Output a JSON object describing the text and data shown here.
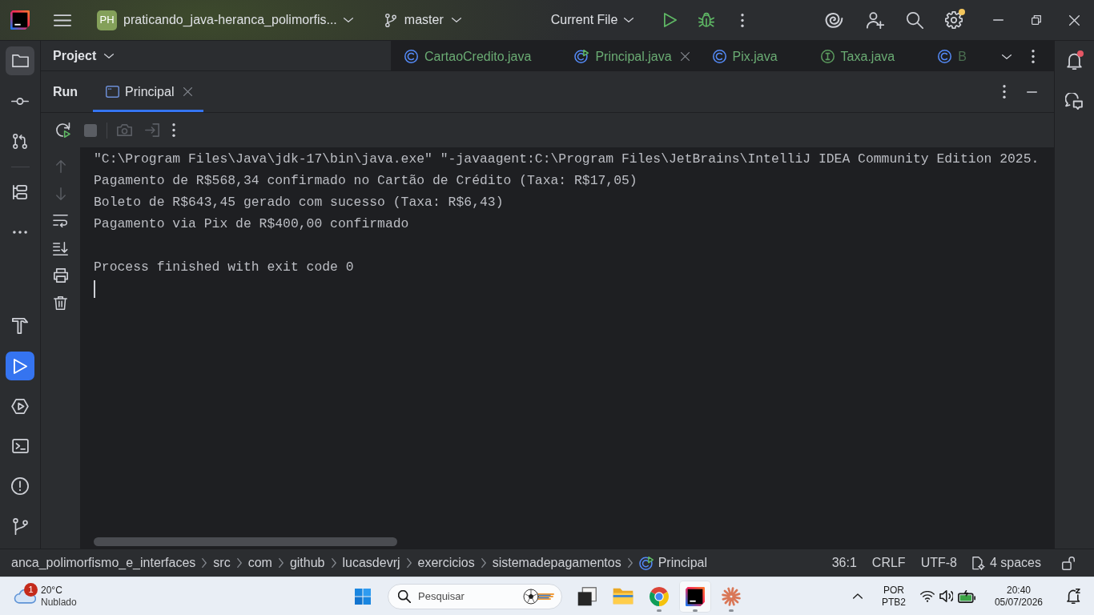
{
  "title_bar": {
    "project_badge": "PH",
    "project_name": "praticando_java-heranca_polimorfis...",
    "branch": "master",
    "run_configuration": "Current File",
    "settings_update_available": true
  },
  "left_toolbar": {
    "top_groups": [
      [
        {
          "kind": "project",
          "selected": false,
          "hovered": true
        },
        {
          "kind": "commit",
          "selected": false,
          "hovered": false
        },
        {
          "kind": "pull_requests",
          "selected": false,
          "hovered": false
        }
      ],
      [
        {
          "kind": "structure",
          "selected": false,
          "hovered": false
        },
        {
          "kind": "more",
          "selected": false,
          "hovered": false
        }
      ]
    ],
    "bottom": [
      {
        "kind": "build",
        "selected": false,
        "hovered": false
      },
      {
        "kind": "run",
        "selected": true,
        "hovered": false
      },
      {
        "kind": "services",
        "selected": false,
        "hovered": false
      },
      {
        "kind": "terminal",
        "selected": false,
        "hovered": false
      },
      {
        "kind": "problems",
        "selected": false,
        "hovered": false
      },
      {
        "kind": "git",
        "selected": false,
        "hovered": false
      }
    ]
  },
  "right_toolbar": [
    {
      "kind": "notifications",
      "badge": true
    },
    {
      "kind": "ai_chat",
      "badge": false
    }
  ],
  "project_panel": {
    "title": "Project"
  },
  "editor_tabs": [
    {
      "label": "CartaoCredito.java",
      "kind": "class",
      "selected": false,
      "cut_off": false
    },
    {
      "label": "Principal.java",
      "kind": "main_class",
      "selected": true,
      "cut_off": false
    },
    {
      "label": "Pix.java",
      "kind": "class",
      "selected": false,
      "cut_off": false
    },
    {
      "label": "Taxa.java",
      "kind": "interface",
      "selected": false,
      "cut_off": false
    },
    {
      "label": "B",
      "kind": "class",
      "selected": false,
      "cut_off": true
    }
  ],
  "run_panel": {
    "title": "Run",
    "tabs": [
      {
        "label": "Principal",
        "selected": true
      }
    ],
    "toolbar_groups": [
      [
        {
          "kind": "rerun",
          "disabled": false
        },
        {
          "kind": "stop",
          "disabled": true
        }
      ],
      [
        {
          "kind": "screenshot",
          "disabled": true
        },
        {
          "kind": "attach",
          "disabled": true
        },
        {
          "kind": "more",
          "disabled": false
        }
      ]
    ],
    "gutter": [
      {
        "kind": "previous",
        "disabled": true
      },
      {
        "kind": "next",
        "disabled": true
      },
      {
        "kind": "soft_wrap",
        "disabled": false
      },
      {
        "kind": "scroll_to_end",
        "disabled": false
      },
      {
        "kind": "print",
        "disabled": false
      },
      {
        "kind": "clear",
        "disabled": false
      }
    ]
  },
  "console": {
    "command": "\"C:\\Program Files\\Java\\jdk-17\\bin\\java.exe\" \"-javaagent:C:\\Program Files\\JetBrains\\IntelliJ IDEA Community Edition 2025.",
    "output": [
      "Pagamento de R$568,34 confirmado no Cartão de Crédito (Taxa: R$17,05)",
      "Boleto de R$643,45 gerado com sucesso (Taxa: R$6,43)",
      "Pagamento via Pix de R$400,00 confirmado"
    ],
    "exit_message": "Process finished with exit code 0",
    "cursor": true
  },
  "status_bar": {
    "breadcrumbs": [
      {
        "label": "anca_polimorfismo_e_interfaces",
        "kind": "package"
      },
      {
        "label": "src",
        "kind": "package"
      },
      {
        "label": "com",
        "kind": "package"
      },
      {
        "label": "github",
        "kind": "package"
      },
      {
        "label": "lucasdevrj",
        "kind": "package"
      },
      {
        "label": "exercicios",
        "kind": "package"
      },
      {
        "label": "sistemadepagamentos",
        "kind": "package"
      },
      {
        "label": "Principal",
        "kind": "main_class"
      }
    ],
    "position": "36:1",
    "line_separator": "CRLF",
    "encoding": "UTF-8",
    "indent": "4 spaces",
    "read_only": false
  },
  "taskbar": {
    "weather": {
      "temperature": "20°C",
      "condition": "Nublado",
      "alerts": "1"
    },
    "search_placeholder": "Pesquisar",
    "apps": [
      {
        "kind": "square",
        "running": false,
        "selected": false
      },
      {
        "kind": "files",
        "running": false,
        "selected": false
      },
      {
        "kind": "browser",
        "running": true,
        "selected": false
      },
      {
        "kind": "ide",
        "running": true,
        "selected": true
      },
      {
        "kind": "sparkle",
        "running": true,
        "selected": false
      }
    ],
    "language": "POR",
    "keyboard": "PTB2",
    "time": "20:40",
    "date": "05/07/2026"
  }
}
